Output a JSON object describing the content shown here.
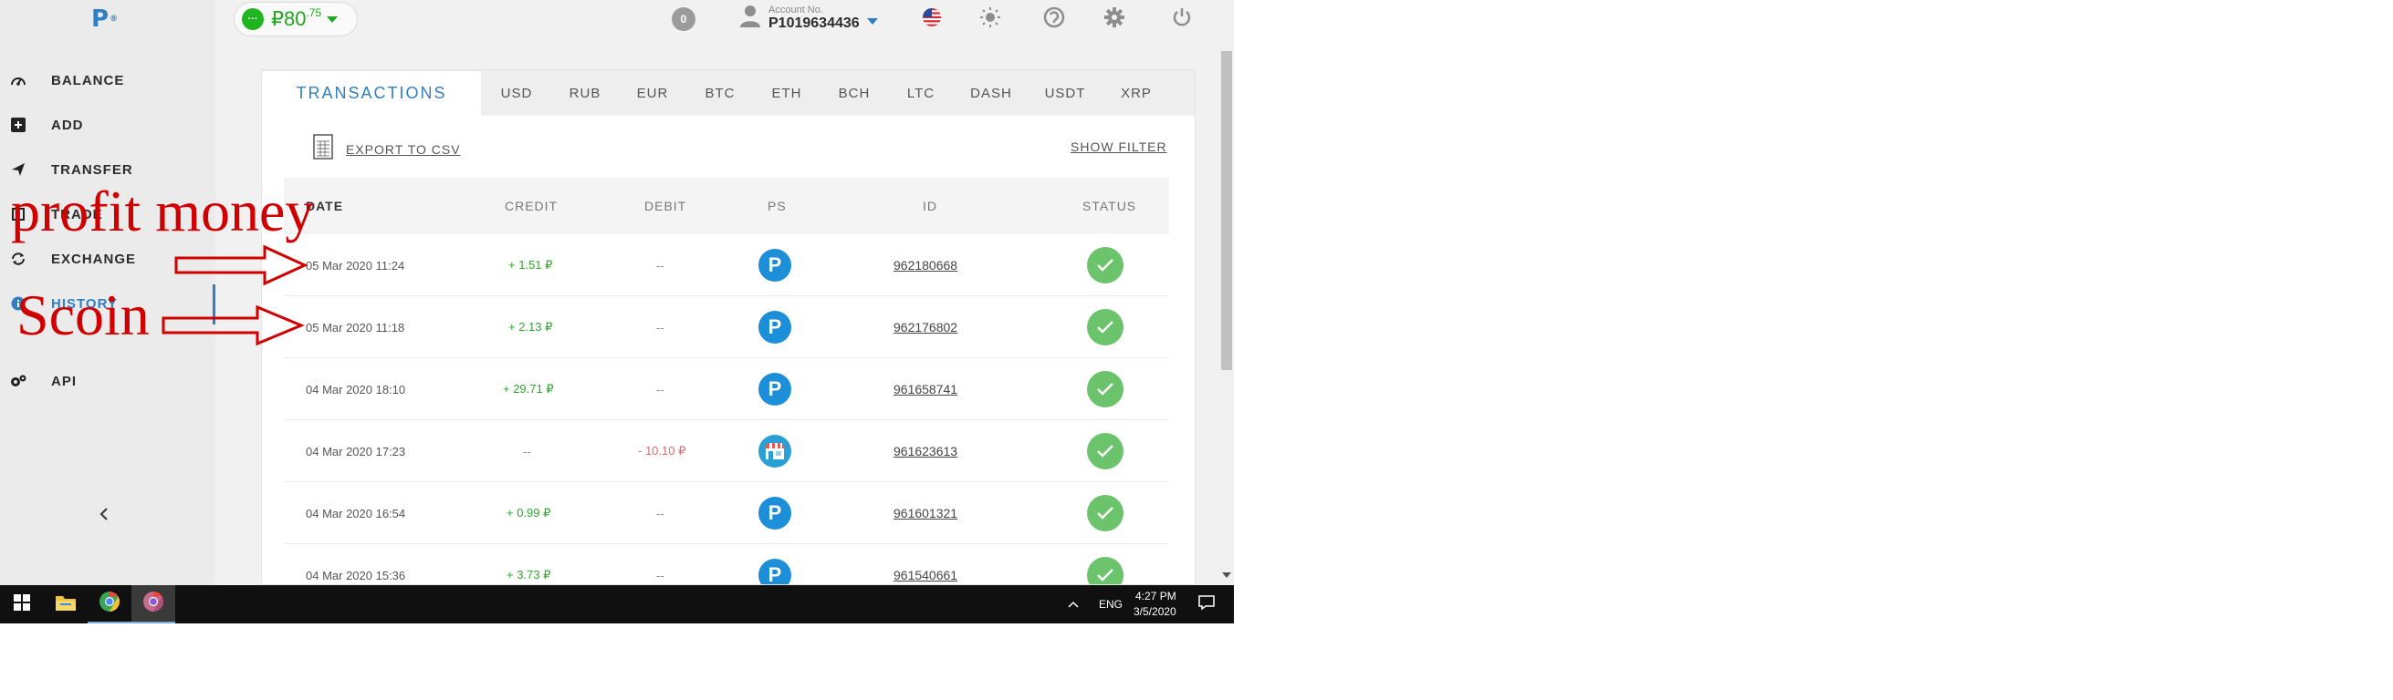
{
  "logo": {
    "letter": "P",
    "mark": "®"
  },
  "sidebar": {
    "items": [
      {
        "label": "BALANCE",
        "icon": "gauge-icon"
      },
      {
        "label": "ADD",
        "icon": "plus-square-icon"
      },
      {
        "label": "TRANSFER",
        "icon": "paper-plane-icon"
      },
      {
        "label": "TRADE",
        "icon": "trade-icon"
      },
      {
        "label": "EXCHANGE",
        "icon": "exchange-icon"
      },
      {
        "label": "HISTORY",
        "icon": "info-icon",
        "active": true
      },
      {
        "label": "API",
        "icon": "gears-icon"
      }
    ]
  },
  "header": {
    "balance_dot": "···",
    "balance_main": "₽80",
    "balance_cents": ".75",
    "notifications": "0",
    "account_caption": "Account No.",
    "account_no": "P1019634436"
  },
  "tabs": [
    {
      "label": "TRANSACTIONS",
      "active": true
    },
    {
      "label": "USD"
    },
    {
      "label": "RUB"
    },
    {
      "label": "EUR"
    },
    {
      "label": "BTC"
    },
    {
      "label": "ETH"
    },
    {
      "label": "BCH"
    },
    {
      "label": "LTC"
    },
    {
      "label": "DASH"
    },
    {
      "label": "USDT"
    },
    {
      "label": "XRP"
    }
  ],
  "toolbar": {
    "export_label": "EXPORT TO CSV",
    "filter_label": "SHOW FILTER"
  },
  "table": {
    "headers": [
      "DATE",
      "CREDIT",
      "DEBIT",
      "PS",
      "ID",
      "STATUS"
    ],
    "rows": [
      {
        "date": "05 Mar 2020 11:24",
        "credit": "+ 1.51 ₽",
        "debit": "--",
        "ps": "P",
        "id": "962180668"
      },
      {
        "date": "05 Mar 2020 11:18",
        "credit": "+ 2.13 ₽",
        "debit": "--",
        "ps": "P",
        "id": "962176802"
      },
      {
        "date": "04 Mar 2020 18:10",
        "credit": "+ 29.71 ₽",
        "debit": "--",
        "ps": "P",
        "id": "961658741"
      },
      {
        "date": "04 Mar 2020 17:23",
        "credit": "--",
        "debit": "- 10.10 ₽",
        "ps": "shop",
        "id": "961623613"
      },
      {
        "date": "04 Mar 2020 16:54",
        "credit": "+ 0.99 ₽",
        "debit": "--",
        "ps": "P",
        "id": "961601321"
      },
      {
        "date": "04 Mar 2020 15:36",
        "credit": "+ 3.73 ₽",
        "debit": "--",
        "ps": "P",
        "id": "961540661"
      }
    ]
  },
  "taskbar": {
    "lang": "ENG",
    "time": "4:27 PM",
    "date": "3/5/2020"
  },
  "annotations": {
    "first": "profit money",
    "second": "Scoin"
  },
  "colors": {
    "accent": "#2f7fc1",
    "credit": "#2ea62e",
    "debit": "#e06a6a",
    "status": "#6bc46b",
    "annotation": "#d10000"
  }
}
